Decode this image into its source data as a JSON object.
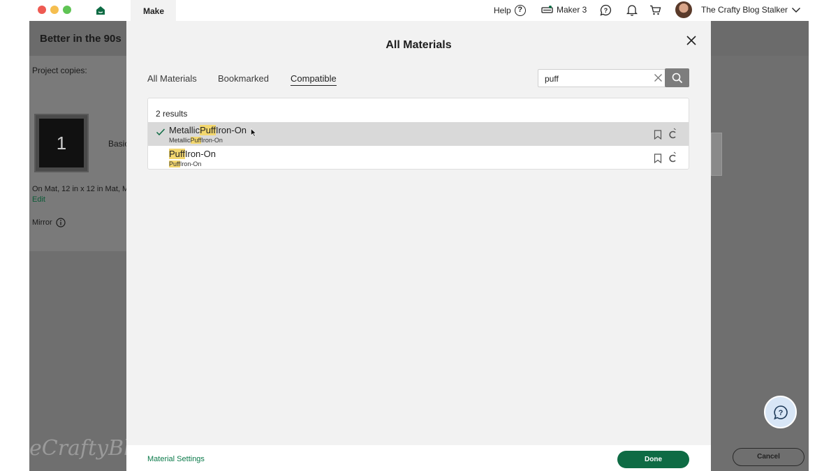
{
  "topbar": {
    "make_tab": "Make",
    "help_label": "Help",
    "machine_label": "Maker 3",
    "user_name": "The Crafty Blog Stalker",
    "colors": {
      "close": "#ee5a52",
      "minimize": "#f5be4f",
      "maximize": "#5fc454",
      "brand": "#0e6b44"
    }
  },
  "background": {
    "project_title": "Better in the 90s",
    "project_copies_label": "Project copies:",
    "mat_number": "1",
    "mat_material_label": "Basic",
    "mat_size_text": "On Mat, 12 in x 12 in Mat, M",
    "edit_link": "Edit",
    "mirror_label": "Mirror",
    "cancel_label": "Cancel",
    "watermark": "eCraftyBlogS"
  },
  "modal": {
    "title": "All Materials",
    "tabs": [
      {
        "label": "All Materials",
        "active": false
      },
      {
        "label": "Bookmarked",
        "active": false
      },
      {
        "label": "Compatible",
        "active": true
      }
    ],
    "search": {
      "value": "puff"
    },
    "results_count": "2 results",
    "results": [
      {
        "pre": "Metallic",
        "match": "Puff",
        "post": "Iron-On",
        "sub_pre": "Metallic",
        "sub_match": "Puff",
        "sub_post": "Iron-On",
        "selected": true
      },
      {
        "pre": "",
        "match": "Puff",
        "post": "Iron-On",
        "sub_pre": "",
        "sub_match": "Puff",
        "sub_post": "Iron-On",
        "selected": false
      }
    ],
    "material_settings_link": "Material Settings",
    "done_label": "Done"
  }
}
